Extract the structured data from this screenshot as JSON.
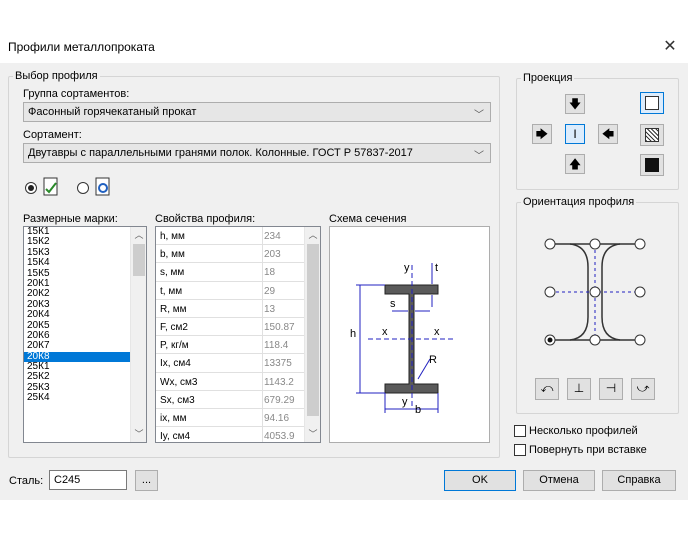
{
  "window": {
    "title": "Профили металлопроката"
  },
  "profile_select": {
    "legend": "Выбор профиля",
    "group_label": "Группа сортаментов:",
    "group_value": "Фасонный горячекатаный прокат",
    "assortment_label": "Сортамент:",
    "assortment_value": "Двутавры с параллельными гранями полок. Колонные. ГОСТ Р 57837-2017",
    "marks_label": "Размерные марки:",
    "marks": [
      "15К1",
      "15К2",
      "15К3",
      "15К4",
      "15К5",
      "20К1",
      "20К2",
      "20К3",
      "20К4",
      "20К5",
      "20К6",
      "20К7",
      "20К8",
      "25К1",
      "25К2",
      "25К3",
      "25К4"
    ],
    "selected_mark": "20К8",
    "props_label": "Свойства профиля:",
    "props": [
      {
        "name": "h, мм",
        "value": "234"
      },
      {
        "name": "b, мм",
        "value": "203"
      },
      {
        "name": "s, мм",
        "value": "18"
      },
      {
        "name": "t, мм",
        "value": "29"
      },
      {
        "name": "R, мм",
        "value": "13"
      },
      {
        "name": "F, см2",
        "value": "150.87"
      },
      {
        "name": "P, кг/м",
        "value": "118.4"
      },
      {
        "name": "Ix, см4",
        "value": "13375"
      },
      {
        "name": "Wx, см3",
        "value": "1143.2"
      },
      {
        "name": "Sx, см3",
        "value": "679.29"
      },
      {
        "name": "ix, мм",
        "value": "94.16"
      },
      {
        "name": "Iy, см4",
        "value": "4053.9"
      }
    ],
    "scheme_label": "Схема сечения",
    "scheme_labels": {
      "y_top": "y",
      "t": "t",
      "s": "s",
      "h": "h",
      "x_left": "x",
      "x_right": "x",
      "r": "R",
      "y_bot": "y",
      "b": "b"
    }
  },
  "projection": {
    "legend": "Проекция"
  },
  "orientation": {
    "legend": "Ориентация профиля"
  },
  "options": {
    "multiple_label": "Несколько профилей",
    "rotate_label": "Повернуть при вставке"
  },
  "steel": {
    "label": "Сталь:",
    "value": "C245",
    "browse_label": "..."
  },
  "buttons": {
    "ok": "OK",
    "cancel": "Отмена",
    "help": "Справка"
  },
  "colors": {
    "accent": "#0078d7",
    "section_fill": "#5a5a5a",
    "dimension": "#2020c0"
  }
}
